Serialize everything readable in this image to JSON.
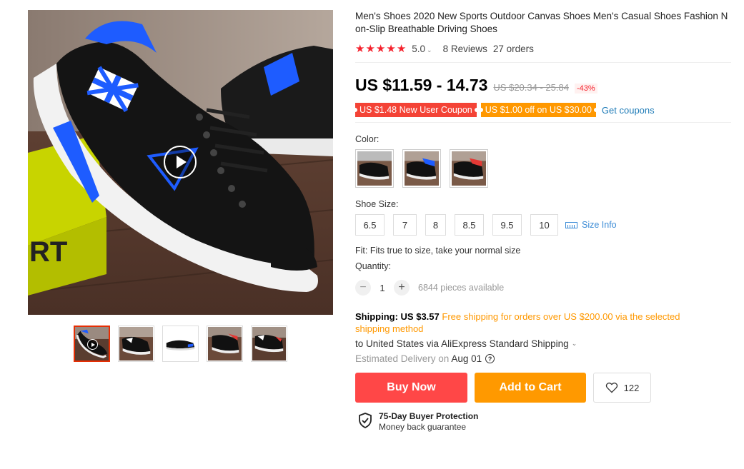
{
  "product": {
    "title": "Men's Shoes 2020 New Sports Outdoor Canvas Shoes Men's Casual Shoes Fashion Non-Slip Breathable Driving Shoes",
    "rating": 5.0,
    "rating_text": "5.0",
    "stars": 5,
    "reviews": "8 Reviews",
    "orders": "27 orders"
  },
  "price": {
    "current": "US $11.59 - 14.73",
    "original": "US $20.34 - 25.84",
    "discount": "-43%"
  },
  "coupons": {
    "new_user": "US $1.48 New User Coupon",
    "store": "US $1.00 off on US $30.00",
    "get_link": "Get coupons"
  },
  "color": {
    "label": "Color:",
    "options": [
      {
        "name": "black-white",
        "accent": "#e0e0e0"
      },
      {
        "name": "black-blue",
        "accent": "#1e5cff"
      },
      {
        "name": "black-red",
        "accent": "#e53935"
      }
    ]
  },
  "size": {
    "label": "Shoe Size:",
    "options": [
      "6.5",
      "7",
      "8",
      "8.5",
      "9.5",
      "10"
    ],
    "info_link": "Size Info"
  },
  "fit": "Fit: Fits true to size, take your normal size",
  "quantity": {
    "label": "Quantity:",
    "value": "1",
    "available": "6844 pieces available"
  },
  "shipping": {
    "label": "Shipping: US $3.57",
    "free_note": "Free shipping for orders over US $200.00 via the selected shipping method",
    "to": "to United States via AliExpress Standard Shipping",
    "eta_label": "Estimated Delivery on",
    "eta_date": "Aug 01"
  },
  "actions": {
    "buy_now": "Buy Now",
    "add_to_cart": "Add to Cart",
    "wishlist_count": "122"
  },
  "protection": {
    "title": "75-Day Buyer Protection",
    "subtitle": "Money back guarantee"
  },
  "colors": {
    "brand_red": "#ff4747",
    "brand_orange": "#ff9900",
    "star": "#f5222d",
    "link": "#1c7ab7"
  },
  "icons": {
    "play": "play-icon",
    "heart": "heart-icon",
    "shield": "shield-check-icon",
    "ruler": "ruler-icon",
    "help": "question-circle-icon"
  }
}
